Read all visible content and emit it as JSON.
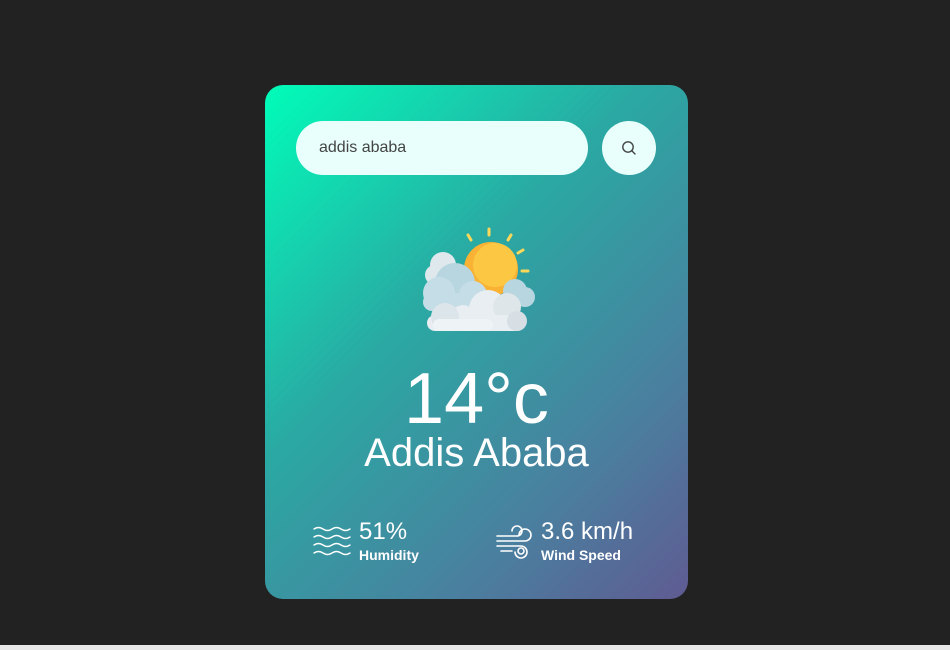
{
  "search": {
    "value": "addis ababa",
    "icon": "search-icon"
  },
  "weather": {
    "icon": "partly-cloudy-icon",
    "temperature": "14°c",
    "city": "Addis Ababa"
  },
  "details": {
    "humidity": {
      "icon": "humidity-icon",
      "value": "51%",
      "label": "Humidity"
    },
    "wind": {
      "icon": "wind-icon",
      "value": "3.6 km/h",
      "label": "Wind Speed"
    }
  },
  "colors": {
    "page_background": "#222222",
    "card_gradient_start": "#00fdb9",
    "card_gradient_end": "#5f5b92",
    "input_background": "#e8fffc",
    "sun": "#f9b233",
    "cloud": "#e8eef2"
  }
}
